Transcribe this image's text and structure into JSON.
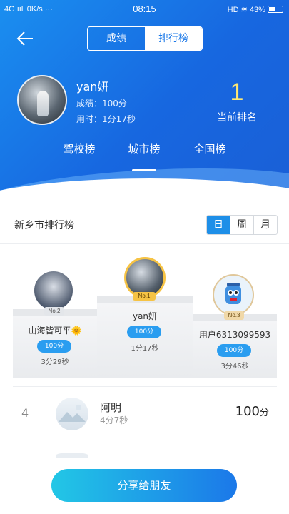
{
  "status_bar": {
    "network": "4G ııll",
    "speed": "0K/s",
    "time": "08:15",
    "hd": "HD",
    "battery": "43%"
  },
  "nav": {
    "tabs": [
      "成绩",
      "排行榜"
    ],
    "active": 1
  },
  "user": {
    "name": "yan妍",
    "score_label": "成绩：",
    "score": "100分",
    "time_label": "用时：",
    "time": "1分17秒"
  },
  "rank": {
    "value": "1",
    "label": "当前排名"
  },
  "scope_tabs": [
    {
      "label": "驾校榜"
    },
    {
      "label": "城市榜"
    },
    {
      "label": "全国榜"
    }
  ],
  "scope_active": 1,
  "board": {
    "title": "新乡市排行榜",
    "periods": [
      "日",
      "周",
      "月"
    ],
    "period_active": 0
  },
  "podium": [
    {
      "badge": "No.2",
      "name": "山海皆可平🌞",
      "score": "100分",
      "time": "3分29秒"
    },
    {
      "badge": "No.1",
      "name": "yan妍",
      "score": "100分",
      "time": "1分17秒"
    },
    {
      "badge": "No.3",
      "name": "用户6313099593",
      "score": "100分",
      "time": "3分46秒"
    }
  ],
  "list": [
    {
      "rank": "4",
      "name": "阿明",
      "time": "4分7秒",
      "score": "100",
      "unit": "分"
    }
  ],
  "share_button": "分享给朋友",
  "colors": {
    "primary": "#1767e0",
    "accent": "#2a9df0",
    "rank_yellow": "#ffe873",
    "gold": "#f6c344"
  }
}
